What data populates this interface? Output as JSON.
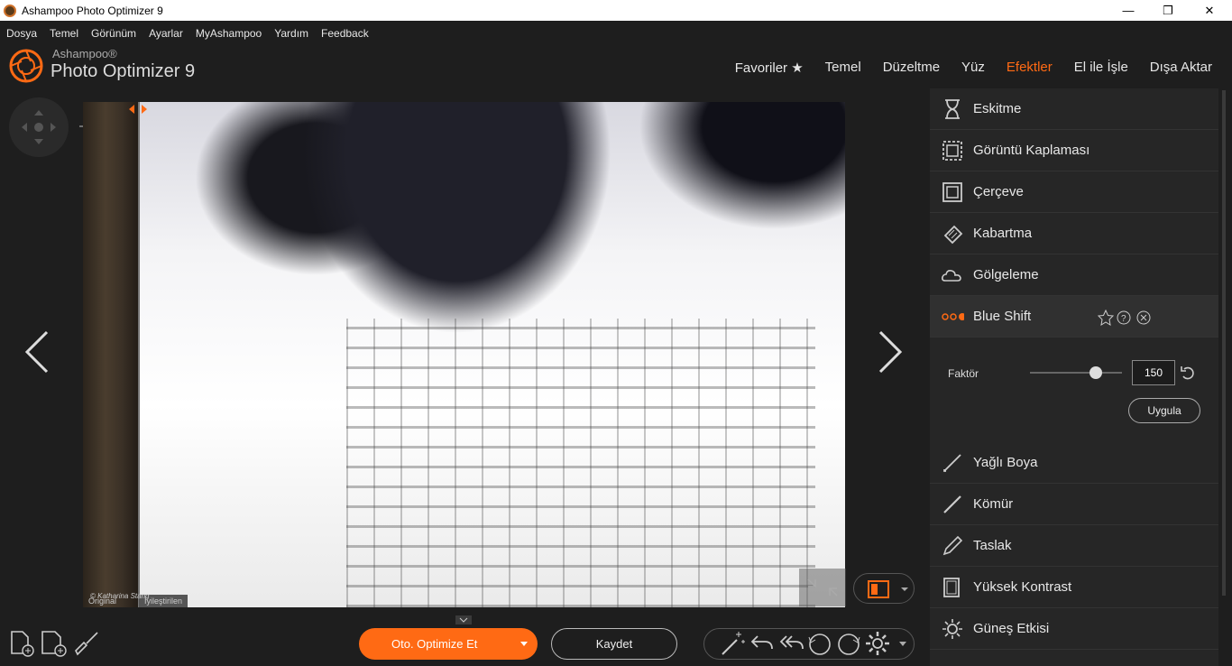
{
  "window": {
    "title": "Ashampoo Photo Optimizer 9",
    "min": "—",
    "max": "❐",
    "close": "✕"
  },
  "menu": [
    "Dosya",
    "Temel",
    "Görünüm",
    "Ayarlar",
    "MyAshampoo",
    "Yardım",
    "Feedback"
  ],
  "brand": {
    "small": "Ashampoo®",
    "big": "Photo Optimizer 9"
  },
  "topnav": [
    "Favoriler ★",
    "Temel",
    "Düzeltme",
    "Yüz",
    "Efektler",
    "El ile İşle",
    "Dışa Aktar"
  ],
  "topnav_active": "Efektler",
  "photo": {
    "label_original": "Original",
    "label_edited": "İyileştirilen",
    "credit": "© Katharina Stang"
  },
  "effects": [
    {
      "label": "Eskitme",
      "icon": "hourglass-icon"
    },
    {
      "label": "Görüntü Kaplaması",
      "icon": "image-overlay-icon"
    },
    {
      "label": "Çerçeve",
      "icon": "frame-icon"
    },
    {
      "label": "Kabartma",
      "icon": "emboss-icon"
    },
    {
      "label": "Gölgeleme",
      "icon": "cloud-icon"
    },
    {
      "label": "Blue Shift",
      "icon": "dots-icon"
    },
    {
      "label": "Yağlı Boya",
      "icon": "brush-icon"
    },
    {
      "label": "Kömür",
      "icon": "pencil-icon"
    },
    {
      "label": "Taslak",
      "icon": "pencil-icon"
    },
    {
      "label": "Yüksek Kontrast",
      "icon": "contrast-icon"
    },
    {
      "label": "Güneş Etkisi",
      "icon": "sun-gear-icon"
    }
  ],
  "selected_effect": "Blue Shift",
  "factor": {
    "label": "Faktör",
    "value": "150",
    "slider_fraction": 0.72
  },
  "apply_label": "Uygula",
  "bottom": {
    "optimize": "Oto. Optimize Et",
    "save": "Kaydet"
  },
  "colors": {
    "accent": "#ff6a14",
    "bg": "#1e1e1e",
    "panel": "#262626"
  }
}
